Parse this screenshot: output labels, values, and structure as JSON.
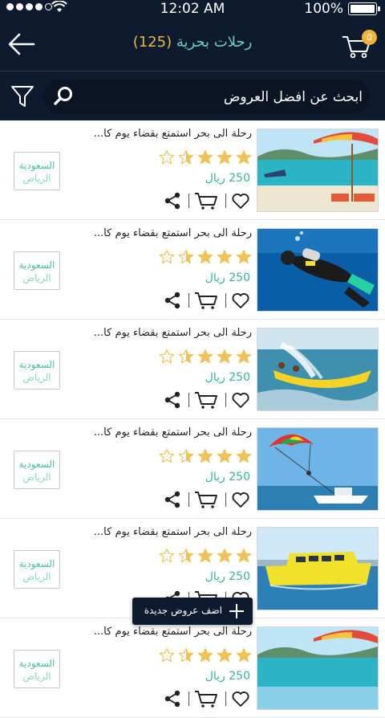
{
  "status": {
    "time": "12:02 AM",
    "battery": "100%"
  },
  "header": {
    "title": "رحلات بحرية",
    "count": "(125)",
    "cart_count": "0"
  },
  "search": {
    "placeholder": "ابحث عن افضل العروض"
  },
  "colors": {
    "header_bg": "#0e1a2e",
    "accent_teal": "#3ab397",
    "star_gold": "#f0c35a",
    "badge_orange": "#f0b43d"
  },
  "icons": [
    "back-arrow-icon",
    "cart-icon",
    "filter-icon",
    "search-icon",
    "star-icon",
    "share-icon",
    "heart-icon",
    "plus-icon"
  ],
  "items": [
    {
      "title": "رحلة الى بحر استمتع بقضاء يوم كا...",
      "rating": 3.5,
      "price": "250 ريال",
      "country": "السعودية",
      "city": "الرياض"
    },
    {
      "title": "رحلة الى بحر استمتع بقضاء يوم كا...",
      "rating": 3.5,
      "price": "250 ريال",
      "country": "السعودية",
      "city": "الرياض"
    },
    {
      "title": "رحلة الى بحر استمتع بقضاء يوم كا...",
      "rating": 3.5,
      "price": "250 ريال",
      "country": "السعودية",
      "city": "الرياض"
    },
    {
      "title": "رحلة الى بحر استمتع بقضاء يوم كا...",
      "rating": 3.5,
      "price": "250 ريال",
      "country": "السعودية",
      "city": "الرياض"
    },
    {
      "title": "رحلة الى بحر استمتع بقضاء يوم كا...",
      "rating": 3.5,
      "price": "250 ريال",
      "country": "السعودية",
      "city": "الرياض"
    },
    {
      "title": "رحلة الى بحر استمتع بقضاء يوم كا...",
      "rating": 3.5,
      "price": "250 ريال",
      "country": "السعودية",
      "city": "الرياض"
    }
  ],
  "fab": {
    "label": "اضف عروض جديدة"
  }
}
